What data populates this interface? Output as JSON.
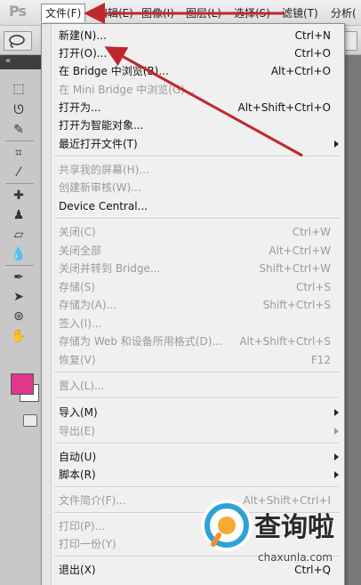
{
  "app": {
    "logo": "Ps"
  },
  "menubar": [
    {
      "label": "文件(F)"
    },
    {
      "label": "编辑(E)"
    },
    {
      "label": "图像(I)"
    },
    {
      "label": "图层(L)"
    },
    {
      "label": "选择(S)"
    },
    {
      "label": "滤镜(T)"
    },
    {
      "label": "分析("
    }
  ],
  "file_menu": {
    "items": [
      {
        "label": "新建(N)...",
        "shortcut": "Ctrl+N",
        "enabled": true
      },
      {
        "label": "打开(O)...",
        "shortcut": "Ctrl+O",
        "enabled": true
      },
      {
        "label": "在 Bridge 中浏览(B)...",
        "shortcut": "Alt+Ctrl+O",
        "enabled": true
      },
      {
        "label": "在 Mini Bridge 中浏览(G)...",
        "shortcut": "",
        "enabled": false
      },
      {
        "label": "打开为...",
        "shortcut": "Alt+Shift+Ctrl+O",
        "enabled": true
      },
      {
        "label": "打开为智能对象...",
        "shortcut": "",
        "enabled": true
      },
      {
        "label": "最近打开文件(T)",
        "shortcut": "",
        "enabled": true,
        "submenu": true
      },
      {
        "label": "共享我的屏幕(H)...",
        "shortcut": "",
        "enabled": false
      },
      {
        "label": "创建新审核(W)...",
        "shortcut": "",
        "enabled": false
      },
      {
        "label": "Device Central...",
        "shortcut": "",
        "enabled": true
      },
      {
        "label": "关闭(C)",
        "shortcut": "Ctrl+W",
        "enabled": false
      },
      {
        "label": "关闭全部",
        "shortcut": "Alt+Ctrl+W",
        "enabled": false
      },
      {
        "label": "关闭并转到 Bridge...",
        "shortcut": "Shift+Ctrl+W",
        "enabled": false
      },
      {
        "label": "存储(S)",
        "shortcut": "Ctrl+S",
        "enabled": false
      },
      {
        "label": "存储为(A)...",
        "shortcut": "Shift+Ctrl+S",
        "enabled": false
      },
      {
        "label": "签入(I)...",
        "shortcut": "",
        "enabled": false
      },
      {
        "label": "存储为 Web 和设备所用格式(D)...",
        "shortcut": "Alt+Shift+Ctrl+S",
        "enabled": false
      },
      {
        "label": "恢复(V)",
        "shortcut": "F12",
        "enabled": false
      },
      {
        "label": "置入(L)...",
        "shortcut": "",
        "enabled": false
      },
      {
        "label": "导入(M)",
        "shortcut": "",
        "enabled": true,
        "submenu": true
      },
      {
        "label": "导出(E)",
        "shortcut": "",
        "enabled": false,
        "submenu": true
      },
      {
        "label": "自动(U)",
        "shortcut": "",
        "enabled": true,
        "submenu": true
      },
      {
        "label": "脚本(R)",
        "shortcut": "",
        "enabled": true,
        "submenu": true
      },
      {
        "label": "文件简介(F)...",
        "shortcut": "Alt+Shift+Ctrl+I",
        "enabled": false
      },
      {
        "label": "打印(P)...",
        "shortcut": "",
        "enabled": false
      },
      {
        "label": "打印一份(Y)",
        "shortcut": "",
        "enabled": false
      },
      {
        "label": "退出(X)",
        "shortcut": "Ctrl+Q",
        "enabled": true
      }
    ]
  },
  "toolbox": {
    "tools": [
      "marquee-tool-icon",
      "lasso-tool-icon",
      "quick-selection-icon",
      "crop-tool-icon",
      "eyedropper-icon",
      "healing-brush-icon",
      "brush-tool-icon",
      "clone-stamp-icon",
      "history-brush-icon",
      "eraser-icon",
      "gradient-icon",
      "blur-icon",
      "dodge-icon",
      "pen-tool-icon",
      "type-tool-icon",
      "path-selection-icon",
      "shape-tool-icon",
      "3d-rotate-icon",
      "3d-camera-icon",
      "hand-tool-icon",
      "zoom-tool-icon"
    ],
    "foreground_color": "#e0378d",
    "background_color": "#ffffff"
  },
  "annotation": {
    "arrow_color": "#c0272d"
  },
  "watermark": {
    "text": "查询啦",
    "url": "chaxunla.com"
  }
}
